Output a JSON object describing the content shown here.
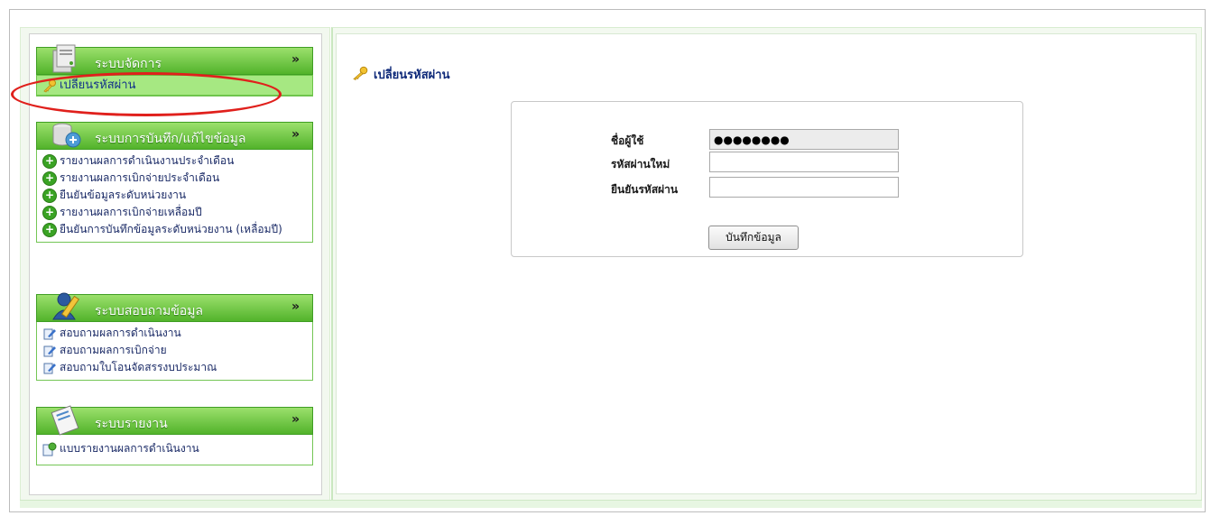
{
  "sidebar": {
    "panels": [
      {
        "title": "ระบบจัดการ",
        "icon": "server-icon",
        "collapse": "»",
        "items": [
          {
            "label": "เปลี่ยนรหัสผ่าน",
            "icon": "key-icon"
          }
        ]
      },
      {
        "title": "ระบบการบันทึก/แก้ไขข้อมูล",
        "icon": "database-edit-icon",
        "collapse": "»",
        "items": [
          {
            "label": "รายงานผลการดำเนินงานประจำเดือน",
            "icon": "plus-circle-icon"
          },
          {
            "label": "รายงานผลการเบิกจ่ายประจำเดือน",
            "icon": "plus-circle-icon"
          },
          {
            "label": "ยืนยันข้อมูลระดับหน่วยงาน",
            "icon": "plus-circle-icon"
          },
          {
            "label": "รายงานผลการเบิกจ่ายเหลื่อมปี",
            "icon": "plus-circle-icon"
          },
          {
            "label": "ยืนยันการบันทึกข้อมูลระดับหน่วยงาน (เหลื่อมปี)",
            "icon": "plus-circle-icon"
          }
        ]
      },
      {
        "title": "ระบบสอบถามข้อมูล",
        "icon": "user-query-icon",
        "collapse": "»",
        "items": [
          {
            "label": "สอบถามผลการดำเนินงาน",
            "icon": "edit-icon"
          },
          {
            "label": "สอบถามผลการเบิกจ่าย",
            "icon": "edit-icon"
          },
          {
            "label": "สอบถามใบโอนจัดสรรงบประมาณ",
            "icon": "edit-icon"
          }
        ]
      },
      {
        "title": "ระบบรายงาน",
        "icon": "report-icon",
        "collapse": "»",
        "items": [
          {
            "label": "แบบรายงานผลการดำเนินงาน",
            "icon": "report-refresh-icon"
          }
        ]
      }
    ]
  },
  "main": {
    "heading": "เปลี่ยนรหัสผ่าน",
    "heading_icon": "key-icon",
    "form": {
      "username_label": "ชื่อผู้ใช้",
      "username_value": "●●●●●●●●",
      "new_password_label": "รหัสผ่านใหม่",
      "new_password_value": "",
      "confirm_password_label": "ยืนยันรหัสผ่าน",
      "confirm_password_value": "",
      "save_label": "บันทึกข้อมูล"
    }
  },
  "colors": {
    "panel_header_top": "#9be06c",
    "panel_header_bottom": "#52b32b",
    "highlight_item": "#a6e882",
    "annotation_oval": "#e0201c",
    "link_text": "#1a2a66"
  }
}
